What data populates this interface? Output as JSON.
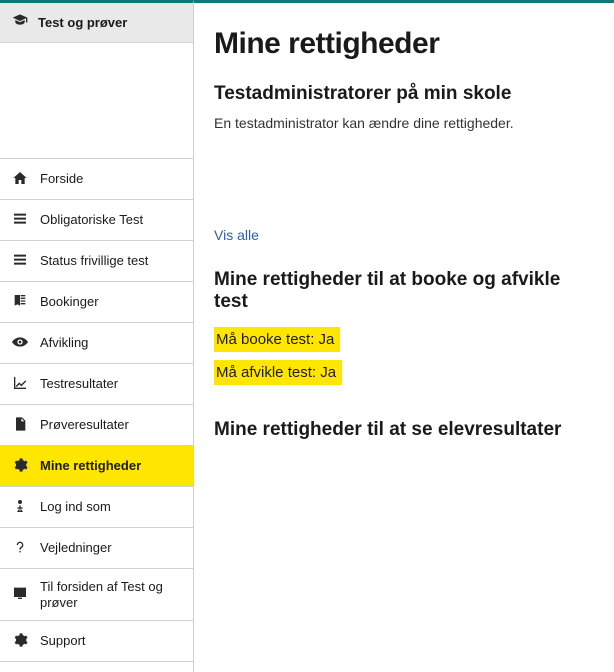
{
  "sidebar": {
    "header": "Test og prøver",
    "items": [
      {
        "label": "Forside",
        "icon": "home"
      },
      {
        "label": "Obligatoriske Test",
        "icon": "list"
      },
      {
        "label": "Status frivillige test",
        "icon": "list"
      },
      {
        "label": "Bookinger",
        "icon": "book"
      },
      {
        "label": "Afvikling",
        "icon": "eye"
      },
      {
        "label": "Testresultater",
        "icon": "chart"
      },
      {
        "label": "Prøveresultater",
        "icon": "doc"
      },
      {
        "label": "Mine rettigheder",
        "icon": "gear",
        "active": true
      },
      {
        "label": "Log ind som",
        "icon": "person"
      },
      {
        "label": "Vejledninger",
        "icon": "question"
      },
      {
        "label": "Til forsiden af Test og prøver",
        "icon": "monitor"
      },
      {
        "label": "Support",
        "icon": "gear"
      }
    ]
  },
  "main": {
    "title": "Mine rettigheder",
    "admins_heading": "Testadministratorer på min skole",
    "admins_desc": "En testadministrator kan ændre dine rettigheder.",
    "show_all": "Vis alle",
    "rights_book_heading": "Mine rettigheder til at booke og afvikle test",
    "rights_book_line": "Må booke test: Ja",
    "rights_run_line": "Må afvikle test: Ja",
    "rights_results_heading": "Mine rettigheder til at se elevresultater"
  }
}
